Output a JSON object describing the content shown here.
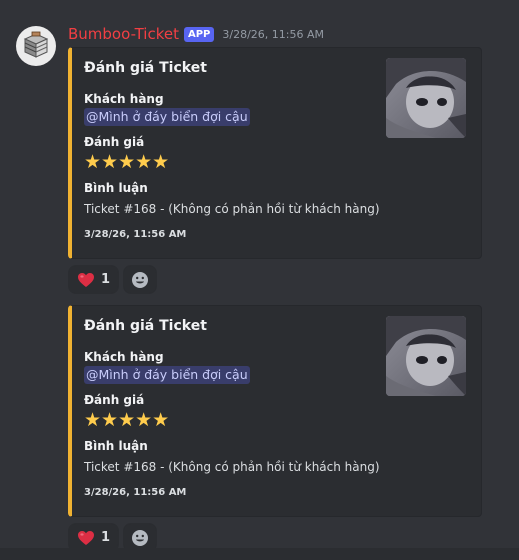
{
  "message": {
    "username": "Bumboo-Ticket",
    "badge": "APP",
    "timestamp": "3/28/26, 11:56 AM"
  },
  "embeds": [
    {
      "title": "Đánh giá Ticket",
      "customer_label": "Khách hàng",
      "customer_mention": "@Mình ở đáy biển đợi cậu",
      "rating_label": "Đánh giá",
      "rating": "★★★★★",
      "comment_label": "Bình luận",
      "comment": "Ticket #168 - (Không có phản hồi từ khách hàng)",
      "footer_timestamp": "3/28/26, 11:56 AM",
      "reaction_emoji": "❤️",
      "reaction_count": "1"
    },
    {
      "title": "Đánh giá Ticket",
      "customer_label": "Khách hàng",
      "customer_mention": "@Mình ở đáy biển đợi cậu",
      "rating_label": "Đánh giá",
      "rating": "★★★★★",
      "comment_label": "Bình luận",
      "comment": "Ticket #168 - (Không có phản hồi từ khách hàng)",
      "footer_timestamp": "3/28/26, 11:56 AM",
      "reaction_emoji": "❤️",
      "reaction_count": "1"
    }
  ],
  "colors": {
    "background": "#313338",
    "embed_background": "#2b2d31",
    "embed_accent": "#f0b232",
    "username": "#f23f43",
    "badge": "#5865f2",
    "mention_text": "#c9cdfb",
    "star": "#ffcc4d"
  }
}
